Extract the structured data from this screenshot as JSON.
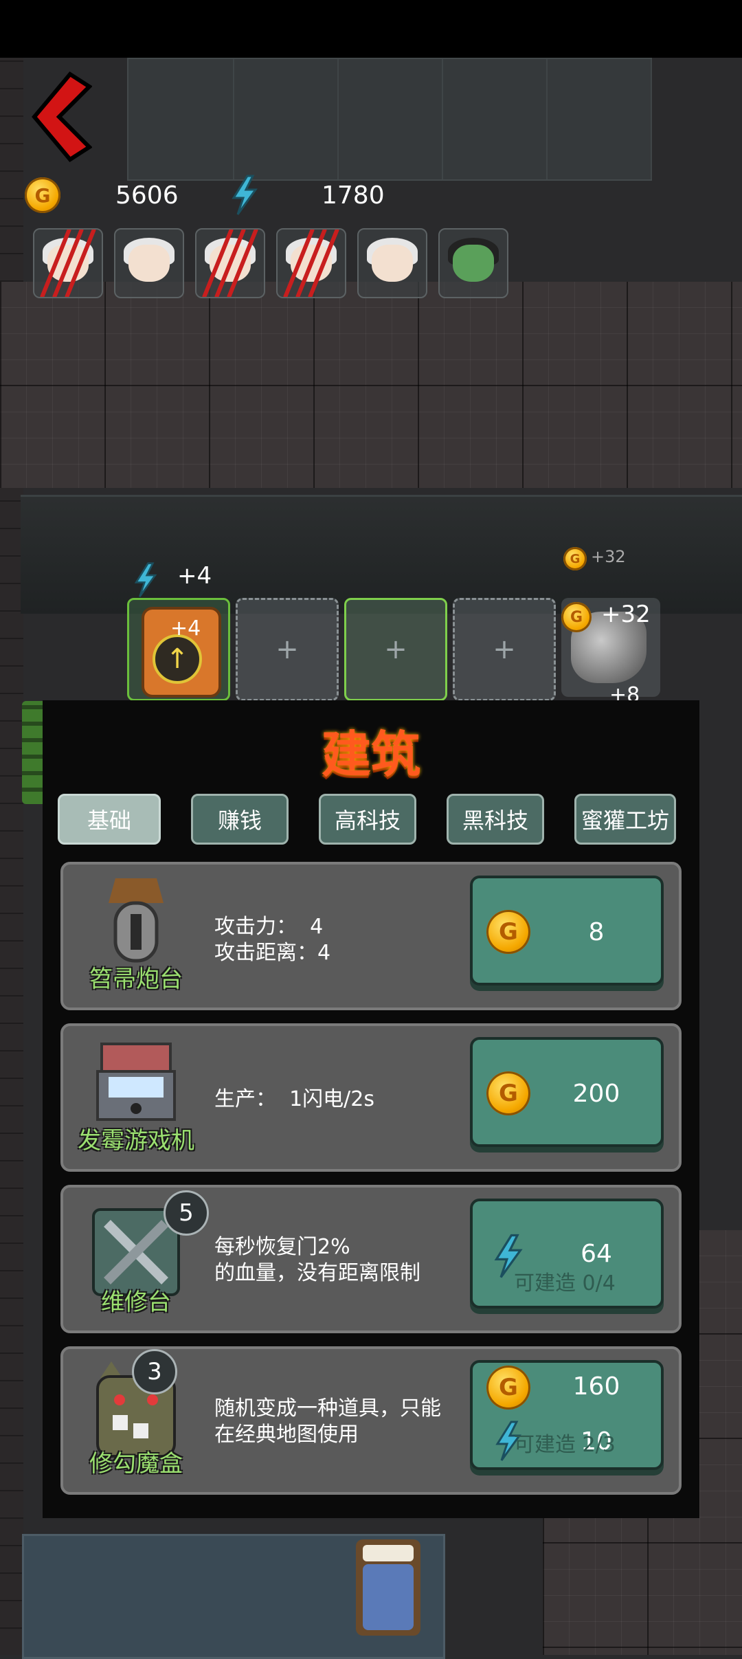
{
  "resources": {
    "gold": "5606",
    "energy": "1780"
  },
  "floor_stats": {
    "energy_gain": "+4",
    "machine_gain": "+4",
    "gold_gain_small": "+32",
    "rock_gold": "+32",
    "rock_extra": "+8"
  },
  "slots": {
    "empty_symbol": "+"
  },
  "panel": {
    "title": "建筑",
    "tabs": [
      "基础",
      "赚钱",
      "高科技",
      "黑科技",
      "蜜獾工坊"
    ],
    "buildings": [
      {
        "name": "笤帚炮台",
        "desc": "攻击力：  4\n攻击距离：4",
        "price": "8",
        "currency": "gold"
      },
      {
        "name": "发霉游戏机",
        "desc": "生产：  1闪电/2s",
        "price": "200",
        "currency": "gold"
      },
      {
        "name": "维修台",
        "badge": "5",
        "desc": "每秒恢复门2%\n的血量，没有距离限制",
        "price": "64",
        "currency": "energy",
        "cap": "可建造 0/4"
      },
      {
        "name": "修勾魔盒",
        "badge": "3",
        "desc": "随机变成一种道具，只能\n在经典地图使用",
        "price": "160",
        "price2": "10",
        "currency": "gold+energy",
        "cap": "可建造 2/3"
      }
    ]
  },
  "icons": {
    "gold": "G",
    "energy": "lightning-icon",
    "back": "back-arrow-icon"
  },
  "colors": {
    "title": "#ff5a1e",
    "buy_button": "#4b8c7a",
    "tab": "#4c6b64",
    "gold": "#f5a800",
    "energy": "#3fb6d6",
    "name": "#9be070"
  }
}
